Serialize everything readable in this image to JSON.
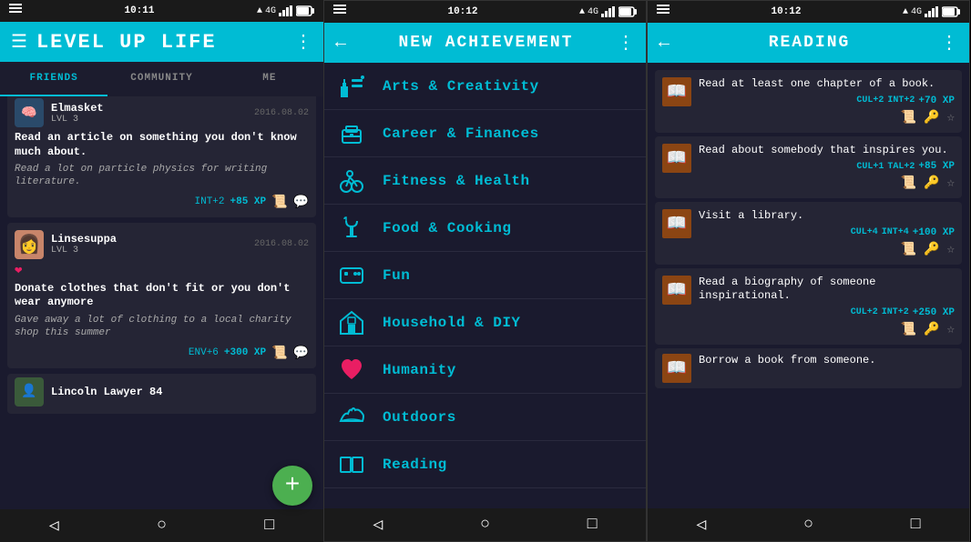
{
  "phones": [
    {
      "id": "phone1",
      "status": {
        "left": "☰",
        "time": "10:11",
        "right": "▲ 4G ■"
      },
      "header": {
        "title": "LEVEL UP LIFE",
        "menu_icon": "⋮"
      },
      "tabs": [
        {
          "label": "FRIENDS",
          "active": true
        },
        {
          "label": "COMMUNITY",
          "active": false
        },
        {
          "label": "ME",
          "active": false
        }
      ],
      "feed": [
        {
          "username": "Elmasket",
          "level": "LVL 3",
          "date": "2016.08.02",
          "title": "Read an article on something you don't know much about.",
          "desc": "Read a lot on particle physics for writing literature.",
          "stat": "INT+2",
          "xp": "+85 XP",
          "has_avatar": false
        },
        {
          "username": "Linsesuppa",
          "level": "LVL 3",
          "date": "2016.08.02",
          "title": "Donate clothes that don't fit or you don't wear anymore",
          "desc": "Gave away a lot of clothing to a local charity shop this summer",
          "stat": "ENV+6",
          "xp": "+300 XP",
          "has_avatar": true
        },
        {
          "username": "Lincoln Lawyer 84",
          "level": "",
          "date": "",
          "title": "",
          "desc": "",
          "stat": "",
          "xp": "",
          "has_avatar": false
        }
      ],
      "fab": "+"
    },
    {
      "id": "phone2",
      "status": {
        "time": "10:12",
        "right": "▲ 4G ■"
      },
      "header": {
        "title": "NEW ACHIEVEMENT"
      },
      "categories": [
        {
          "name": "Arts & Creativity",
          "icon": "🎵"
        },
        {
          "name": "Career & Finances",
          "icon": "💼"
        },
        {
          "name": "Fitness & Health",
          "icon": "🚲"
        },
        {
          "name": "Food & Cooking",
          "icon": "🍵"
        },
        {
          "name": "Fun",
          "icon": "🎮"
        },
        {
          "name": "Household & DIY",
          "icon": "🏠"
        },
        {
          "name": "Humanity",
          "icon": "❤️"
        },
        {
          "name": "Outdoors",
          "icon": "☁️"
        },
        {
          "name": "Reading",
          "icon": "📖"
        }
      ]
    },
    {
      "id": "phone3",
      "status": {
        "time": "10:12",
        "right": "▲ 4G ■"
      },
      "header": {
        "title": "READING"
      },
      "items": [
        {
          "title": "Read at least one chapter of a book.",
          "stats": "CUL+2  INT+2",
          "xp": "+70 XP",
          "actions": [
            "📜",
            "🔑",
            "☆"
          ]
        },
        {
          "title": "Read about somebody that inspires you.",
          "stats": "CUL+1  TAL+2",
          "xp": "+85 XP",
          "actions": [
            "📜",
            "🔑",
            "☆"
          ]
        },
        {
          "title": "Visit a library.",
          "stats": "CUL+4  INT+4",
          "xp": "+100 XP",
          "actions": [
            "📜",
            "🔑",
            "☆"
          ]
        },
        {
          "title": "Read a biography of someone inspirational.",
          "stats": "CUL+2  INT+2",
          "xp": "+250 XP",
          "actions": [
            "📜",
            "🔑",
            "☆"
          ]
        },
        {
          "title": "Borrow a book from someone.",
          "stats": "",
          "xp": "",
          "actions": []
        }
      ]
    }
  ]
}
